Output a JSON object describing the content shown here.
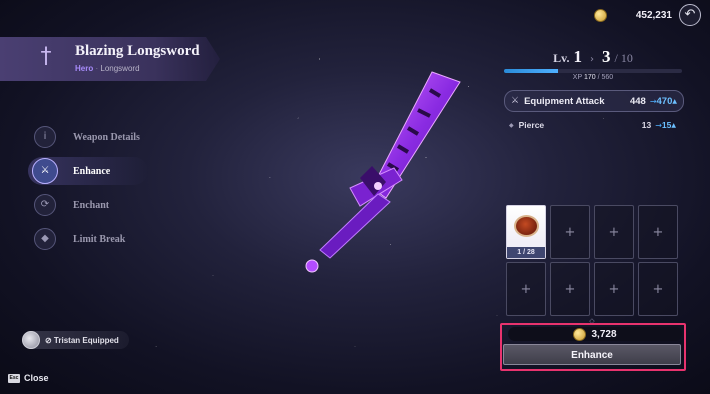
{
  "header": {
    "currency_icon": "gold-coin-icon",
    "currency_amount": "452,231",
    "back_icon": "return-arrow-icon"
  },
  "item": {
    "name": "Blazing Longsword",
    "class": "Hero",
    "separator": "·",
    "type": "Longsword",
    "icon": "sword-icon"
  },
  "nav": {
    "items": [
      {
        "label": "Weapon Details",
        "icon": "info-icon",
        "glyph": "i"
      },
      {
        "label": "Enhance",
        "icon": "enhance-icon",
        "glyph": "⚔",
        "active": true
      },
      {
        "label": "Enchant",
        "icon": "enchant-icon",
        "glyph": "⟳"
      },
      {
        "label": "Limit Break",
        "icon": "limit-break-icon",
        "glyph": "◆"
      }
    ]
  },
  "equipped": {
    "text": "⊘ Tristan Equipped"
  },
  "footer": {
    "key": "Esc",
    "close_label": "Close"
  },
  "level": {
    "label": "Lv.",
    "current": "1",
    "arrow": "›",
    "target": "3",
    "max": "/ 10",
    "xp_label": "XP",
    "xp_current": "170",
    "xp_max": "/ 560",
    "xp_fraction": 0.3036
  },
  "stats": {
    "main": {
      "name": "Equipment Attack",
      "value": "448",
      "arrow": "→",
      "new_value": "470",
      "up": "▲",
      "icon": "sword-icon"
    },
    "sub": {
      "name": "Pierce",
      "value": "13",
      "arrow": "→",
      "new_value": "15",
      "up": "▲",
      "icon": "diamond-icon"
    }
  },
  "materials": {
    "filled_count": "1 / 28",
    "empty_glyph": "+",
    "filled_icon": "food-material-icon"
  },
  "enhance": {
    "cost": "3,728",
    "button_label": "Enhance",
    "highlight_color": "#e8336e"
  },
  "colors": {
    "accent": "#a78bfa",
    "stat_up": "#6cc0ff",
    "xp_bar": "#4fb0ff"
  }
}
